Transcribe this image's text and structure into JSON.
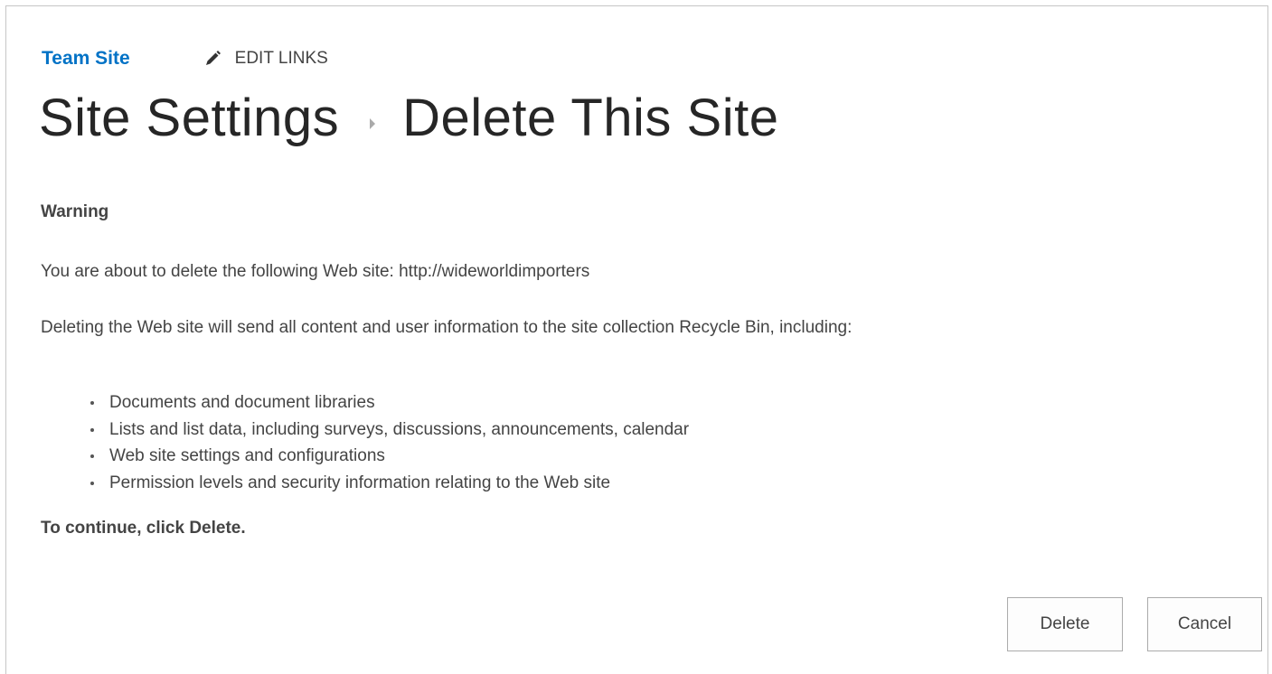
{
  "header": {
    "site_link": "Team Site",
    "edit_links_label": "EDIT LINKS",
    "edit_links_icon": "pencil-icon"
  },
  "title": {
    "parent": "Site Settings",
    "separator_icon": "chevron-right-icon",
    "current": "Delete This Site"
  },
  "content": {
    "warning_title": "Warning",
    "intro": "You are about to delete the following Web site: http://wideworldimporters",
    "description": "Deleting the Web site will send all content and user information to the site collection Recycle Bin, including:",
    "items": [
      "Documents and document libraries",
      "Lists and list data, including surveys, discussions, announcements, calendar",
      "Web site settings and configurations",
      "Permission levels and security information relating to the Web site"
    ],
    "continue_text": "To continue, click Delete."
  },
  "buttons": {
    "delete_label": "Delete",
    "cancel_label": "Cancel"
  },
  "colors": {
    "link": "#0072c6",
    "text": "#444444",
    "title": "#262626",
    "border": "#c6c6c6"
  }
}
